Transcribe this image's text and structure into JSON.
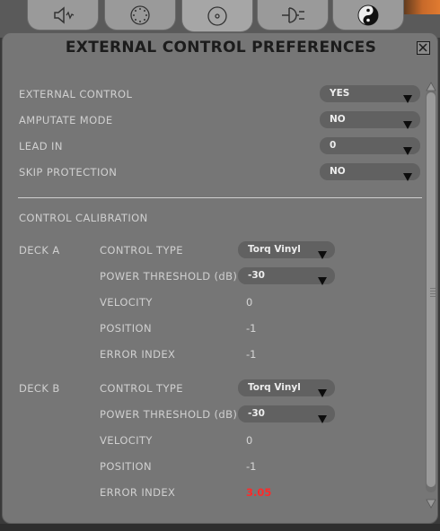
{
  "window": {
    "title": "EXTERNAL CONTROL PREFERENCES"
  },
  "tabs": [
    {
      "name": "speaker-icon",
      "active": false
    },
    {
      "name": "dotted-circle-icon",
      "active": false
    },
    {
      "name": "target-icon",
      "active": true
    },
    {
      "name": "plug-icon",
      "active": false
    },
    {
      "name": "yin-yang-icon",
      "active": false
    }
  ],
  "prefs": {
    "external_control": {
      "label": "EXTERNAL CONTROL",
      "value": "YES"
    },
    "amputate_mode": {
      "label": "AMPUTATE MODE",
      "value": "NO"
    },
    "lead_in": {
      "label": "LEAD IN",
      "value": "0"
    },
    "skip_protection": {
      "label": "SKIP PROTECTION",
      "value": "NO"
    }
  },
  "calibration": {
    "heading": "CONTROL CALIBRATION",
    "deck_a": {
      "label": "DECK A",
      "control_type": {
        "label": "CONTROL TYPE",
        "value": "Torq Vinyl"
      },
      "power_threshold": {
        "label": "POWER THRESHOLD (dB)",
        "value": "-30"
      },
      "velocity": {
        "label": "VELOCITY",
        "value": "0"
      },
      "position": {
        "label": "POSITION",
        "value": "-1"
      },
      "error_index": {
        "label": "ERROR INDEX",
        "value": "-1"
      }
    },
    "deck_b": {
      "label": "DECK B",
      "control_type": {
        "label": "CONTROL TYPE",
        "value": "Torq Vinyl"
      },
      "power_threshold": {
        "label": "POWER THRESHOLD (dB)",
        "value": "-30"
      },
      "velocity": {
        "label": "VELOCITY",
        "value": "0"
      },
      "position": {
        "label": "POSITION",
        "value": "-1"
      },
      "error_index": {
        "label": "ERROR INDEX",
        "value": "3.05"
      }
    }
  },
  "colors": {
    "window_bg": "#767676",
    "dropdown_bg": "#616161",
    "error_highlight": "#ff2a2a"
  }
}
